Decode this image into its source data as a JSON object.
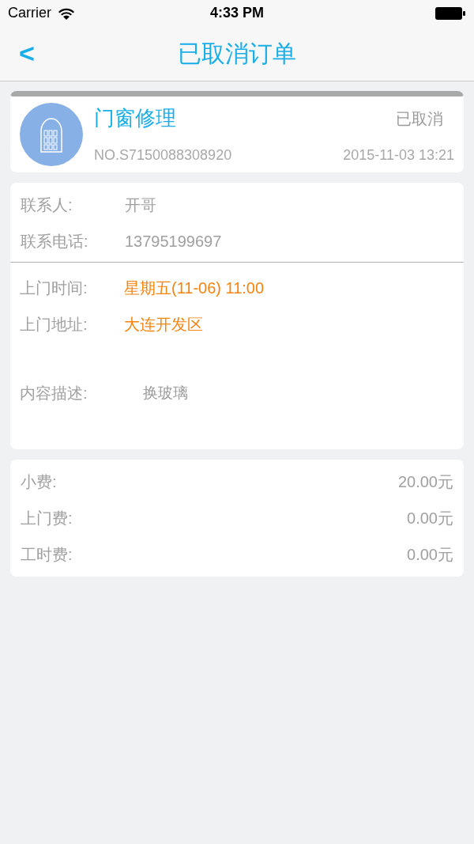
{
  "status_bar": {
    "carrier": "Carrier",
    "time": "4:33 PM"
  },
  "nav": {
    "back": "<",
    "title": "已取消订单"
  },
  "order": {
    "service": "门窗修理",
    "status": "已取消",
    "number": "NO.S7150088308920",
    "datetime": "2015-11-03 13:21"
  },
  "contact": [
    {
      "label": "联系人:",
      "value": "开哥",
      "kind": "plain"
    },
    {
      "label": "联系电话:",
      "value": "13795199697",
      "kind": "plain"
    }
  ],
  "visit": [
    {
      "label": "上门时间:",
      "value": "星期五(11-06) 11:00",
      "kind": "highlight"
    },
    {
      "label": "上门地址:",
      "value": "大连开发区",
      "kind": "highlight"
    }
  ],
  "description": {
    "label": "内容描述:",
    "value": "换玻璃"
  },
  "fees": [
    {
      "label": "小费:",
      "value": "20.00元"
    },
    {
      "label": "上门费:",
      "value": "0.00元"
    },
    {
      "label": "工时费:",
      "value": "0.00元"
    }
  ]
}
